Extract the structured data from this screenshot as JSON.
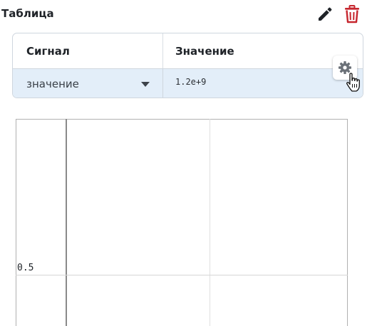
{
  "panel": {
    "title": "Таблица",
    "edit_icon": "pencil-icon",
    "delete_icon": "trash-icon",
    "delete_color": "#c6262e"
  },
  "table": {
    "headers": [
      "Сигнал",
      "Значение"
    ],
    "row": {
      "signal_selected": "значение",
      "value": "1.2e+9"
    },
    "row_background": "#e3eef9"
  },
  "settings": {
    "icon": "gear-icon"
  },
  "chart": {
    "y_tick_labels": [
      "0.5"
    ]
  }
}
